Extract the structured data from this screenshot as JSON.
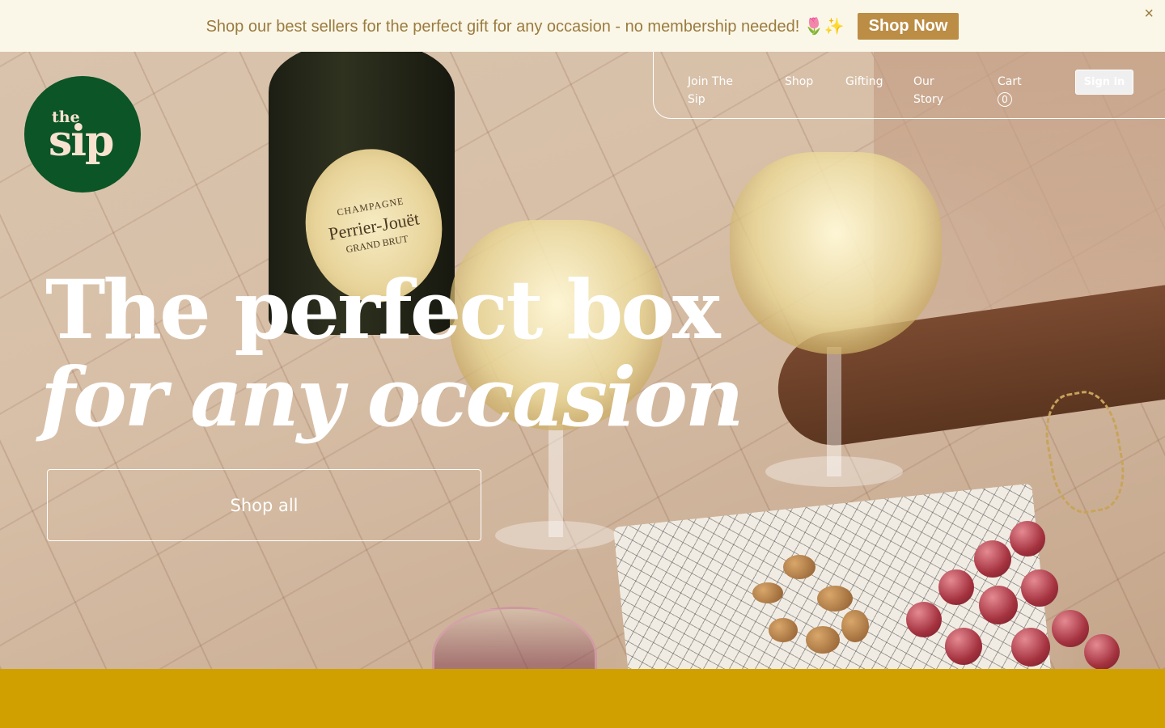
{
  "announcement": {
    "text": "Shop our best sellers for the perfect gift for any occasion - no membership needed! 🌷✨",
    "cta_label": "Shop Now",
    "close_label": "×"
  },
  "brand": {
    "logo_top": "the",
    "logo_main": "sip",
    "logo_bg": "#0b5526",
    "accent": "#cfa000",
    "promo_button": "#bb8d45"
  },
  "nav": {
    "items": [
      {
        "label": "Join The Sip"
      },
      {
        "label": "Shop"
      },
      {
        "label": "Gifting"
      },
      {
        "label": "Our Story"
      },
      {
        "label": "Cart"
      }
    ],
    "cart_count": "0",
    "signin_label": "Sign in"
  },
  "hero": {
    "headline_line1": "The perfect box",
    "headline_line2": "for any occasion",
    "cta_label": "Shop all",
    "bottle_label": {
      "line1": "CHAMPAGNE",
      "line2": "Perrier-Jouët",
      "line3": "GRAND BRUT"
    }
  }
}
